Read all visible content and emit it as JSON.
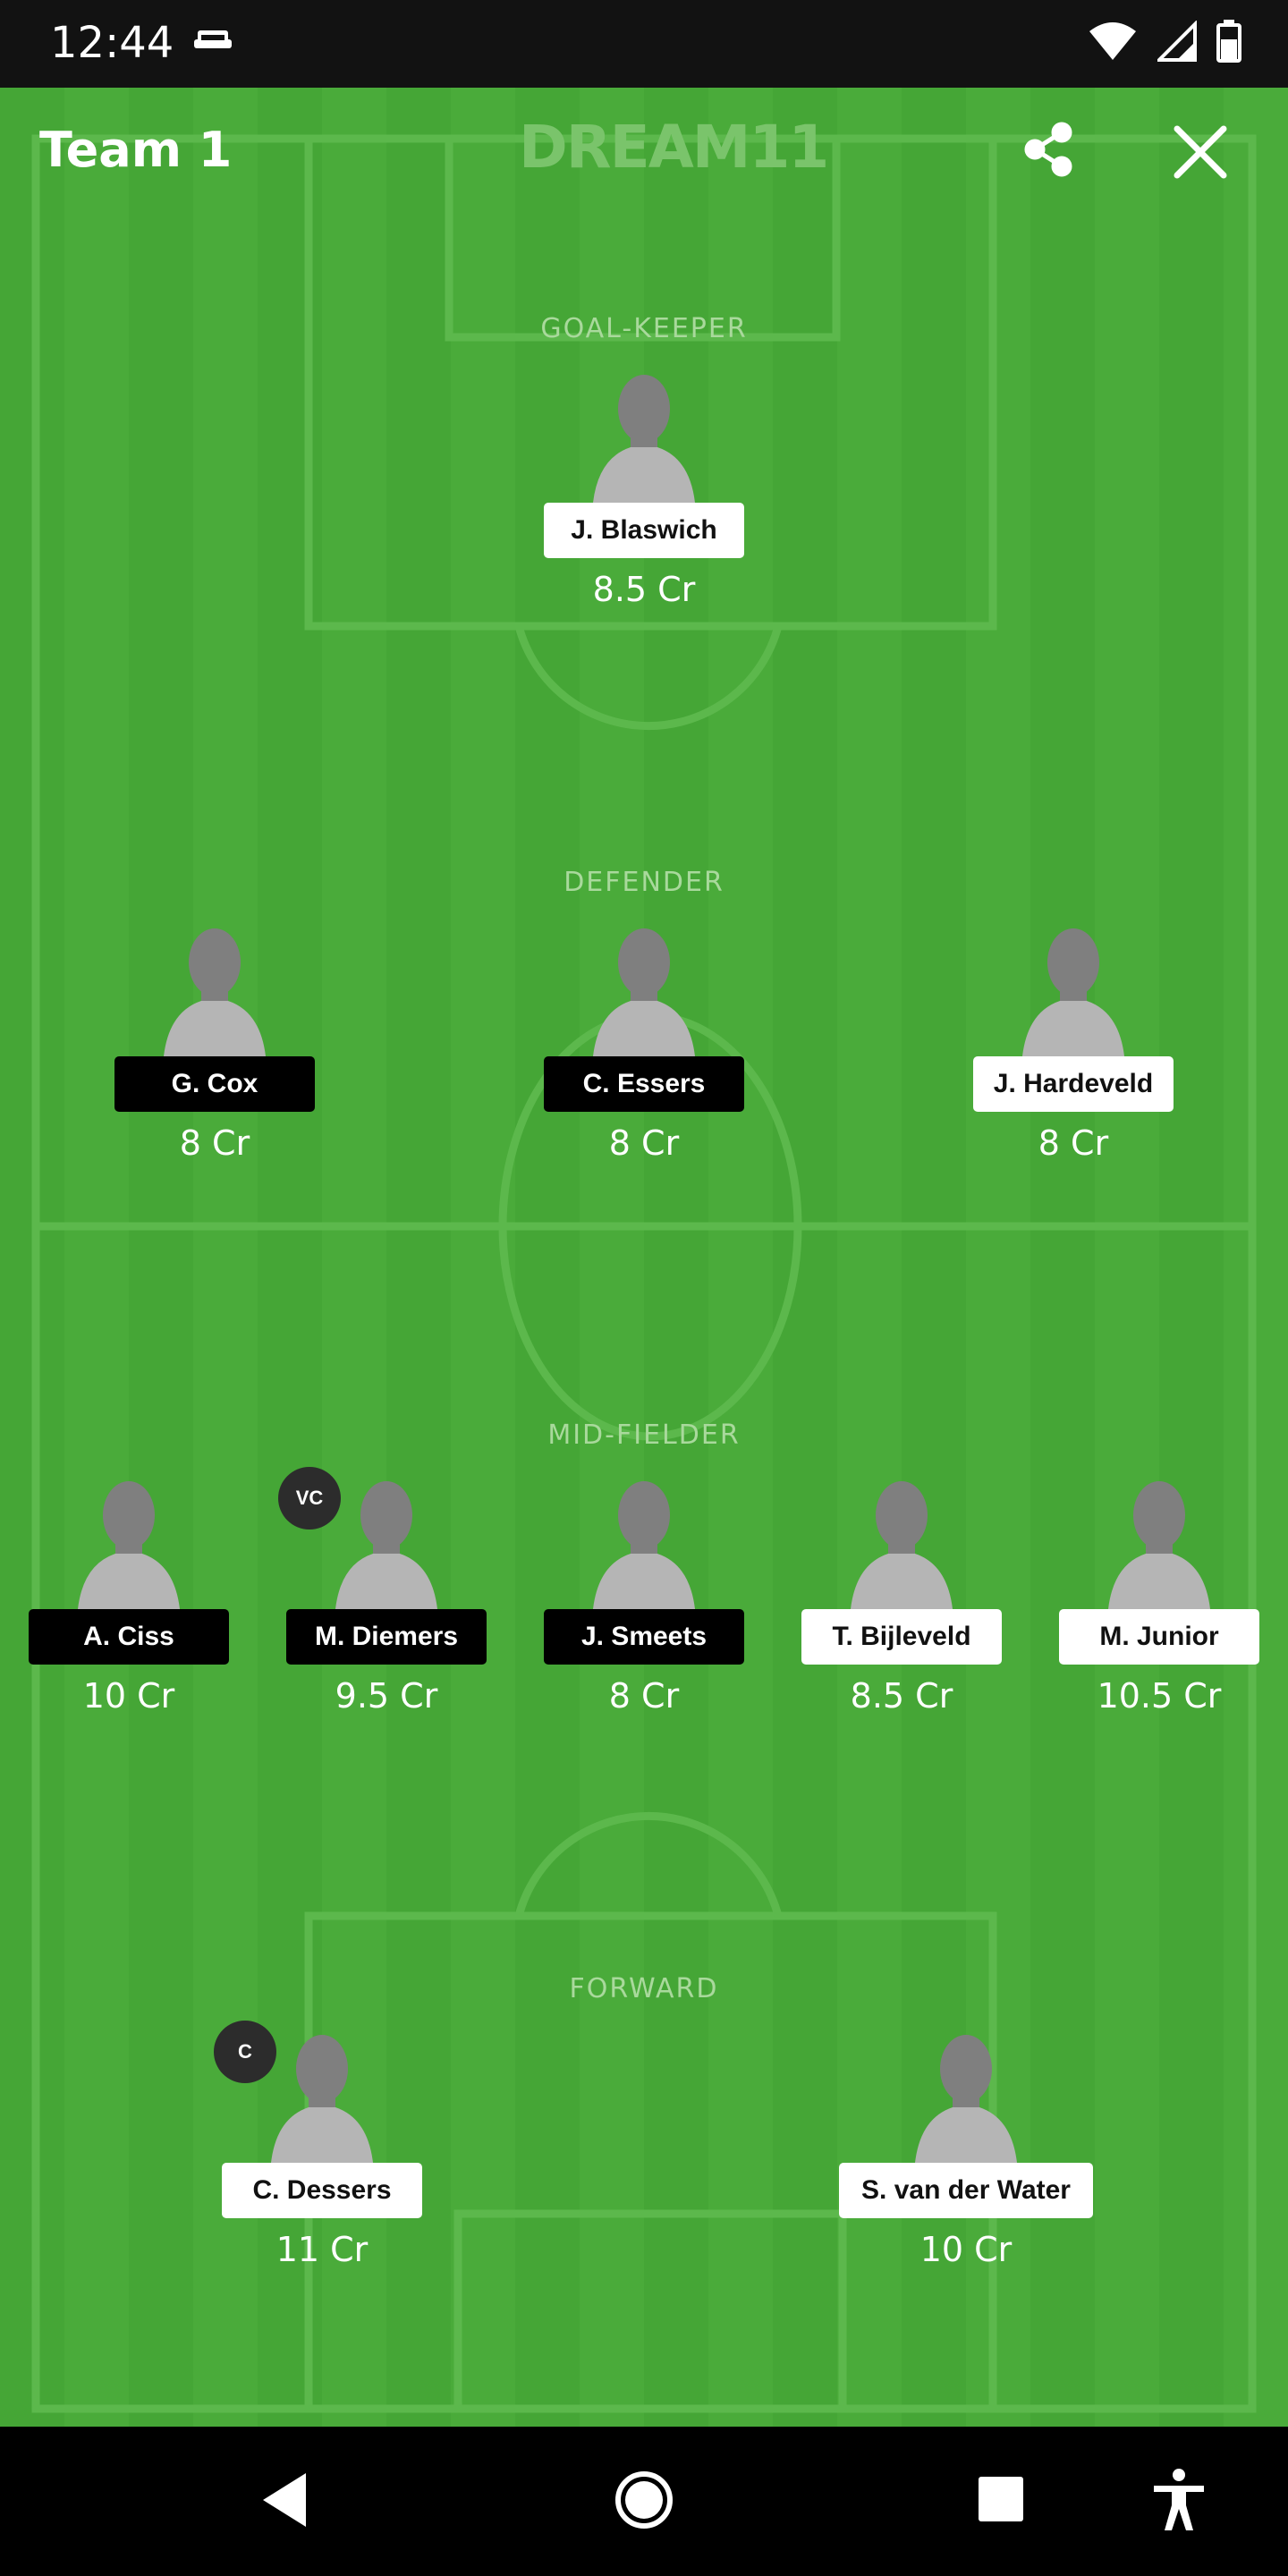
{
  "status_bar": {
    "time": "12:44"
  },
  "header": {
    "title": "Team 1",
    "brand": "DREAM11"
  },
  "sections": {
    "goalkeeper": "GOAL-KEEPER",
    "defender": "DEFENDER",
    "midfielder": "MID-FIELDER",
    "forward": "FORWARD"
  },
  "players": {
    "gk": [
      {
        "name": "J. Blaswich",
        "price": "8.5 Cr",
        "style": "light"
      }
    ],
    "def": [
      {
        "name": "G. Cox",
        "price": "8 Cr",
        "style": "dark"
      },
      {
        "name": "C. Essers",
        "price": "8 Cr",
        "style": "dark"
      },
      {
        "name": "J. Hardeveld",
        "price": "8 Cr",
        "style": "light"
      }
    ],
    "mid": [
      {
        "name": "A. Ciss",
        "price": "10 Cr",
        "style": "dark"
      },
      {
        "name": "M. Diemers",
        "price": "9.5 Cr",
        "style": "dark",
        "badge": "VC"
      },
      {
        "name": "J. Smeets",
        "price": "8 Cr",
        "style": "dark"
      },
      {
        "name": "T. Bijleveld",
        "price": "8.5 Cr",
        "style": "light"
      },
      {
        "name": "M. Junior",
        "price": "10.5 Cr",
        "style": "light"
      }
    ],
    "fwd": [
      {
        "name": "C. Dessers",
        "price": "11 Cr",
        "style": "light",
        "badge": "C"
      },
      {
        "name": "S. van der Water",
        "price": "10 Cr",
        "style": "light"
      }
    ]
  },
  "icons": {
    "share": "share-icon",
    "close": "close-icon",
    "back": "back-triangle-icon",
    "home": "home-circle-icon",
    "recents": "recents-square-icon",
    "accessibility": "accessibility-icon"
  },
  "colors": {
    "pitch": "#45a636",
    "pitch_alt": "#4aab3a",
    "lines": "#5cb84c",
    "label": "#a9d99c"
  }
}
